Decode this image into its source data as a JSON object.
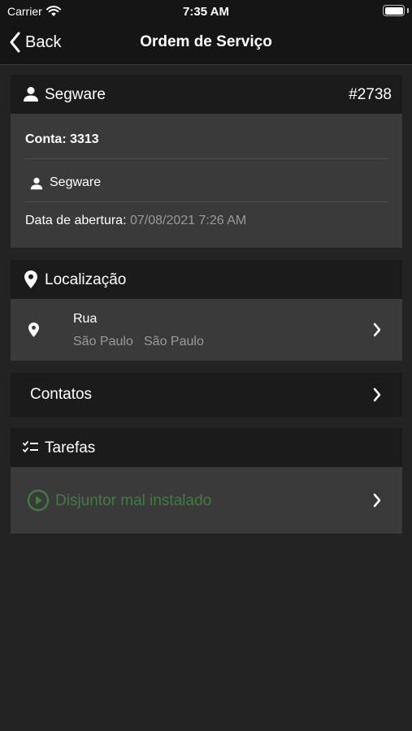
{
  "status_bar": {
    "carrier": "Carrier",
    "time": "7:35 AM"
  },
  "navbar": {
    "back_label": "Back",
    "title": "Ordem de Serviço"
  },
  "order": {
    "client_name": "Segware",
    "number": "#2738",
    "account": "Conta: 3313",
    "responsible": "Segware",
    "opening_label": "Data de abertura:",
    "opening_date": "07/08/2021 7:26 AM"
  },
  "location": {
    "section_label": "Localização",
    "street": "Rua",
    "city": "São Paulo",
    "state": "São Paulo"
  },
  "contacts": {
    "label": "Contatos"
  },
  "tasks": {
    "section_label": "Tarefas",
    "items": [
      {
        "label": "Disjuntor mal instalado",
        "color": "#3f7d3f"
      }
    ]
  },
  "colors": {
    "background": "#232323",
    "header": "#1b1b1b",
    "card": "#3a3a3a",
    "muted": "#9a9a9a",
    "task_green": "#3f7d3f"
  }
}
